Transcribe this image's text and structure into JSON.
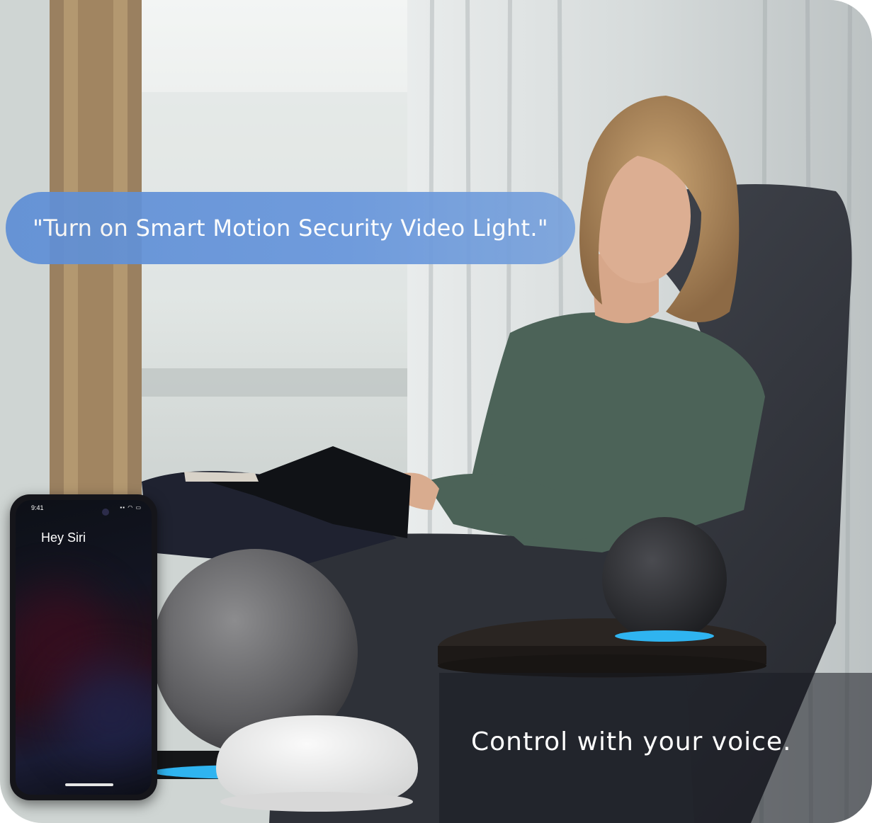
{
  "bubble": {
    "text": "\"Turn on Smart Motion Security Video Light.\""
  },
  "tagline": {
    "text": "Control with your voice."
  },
  "phone": {
    "status_time": "9:41",
    "status_icons": "signal-icon wifi-icon battery-icon",
    "prompt_text": "Hey Siri"
  },
  "colors": {
    "bubble": "#6796dc",
    "speaker_ring": "#2fb4f0",
    "chair": "#3a3d44",
    "sweater": "#4c6358"
  }
}
